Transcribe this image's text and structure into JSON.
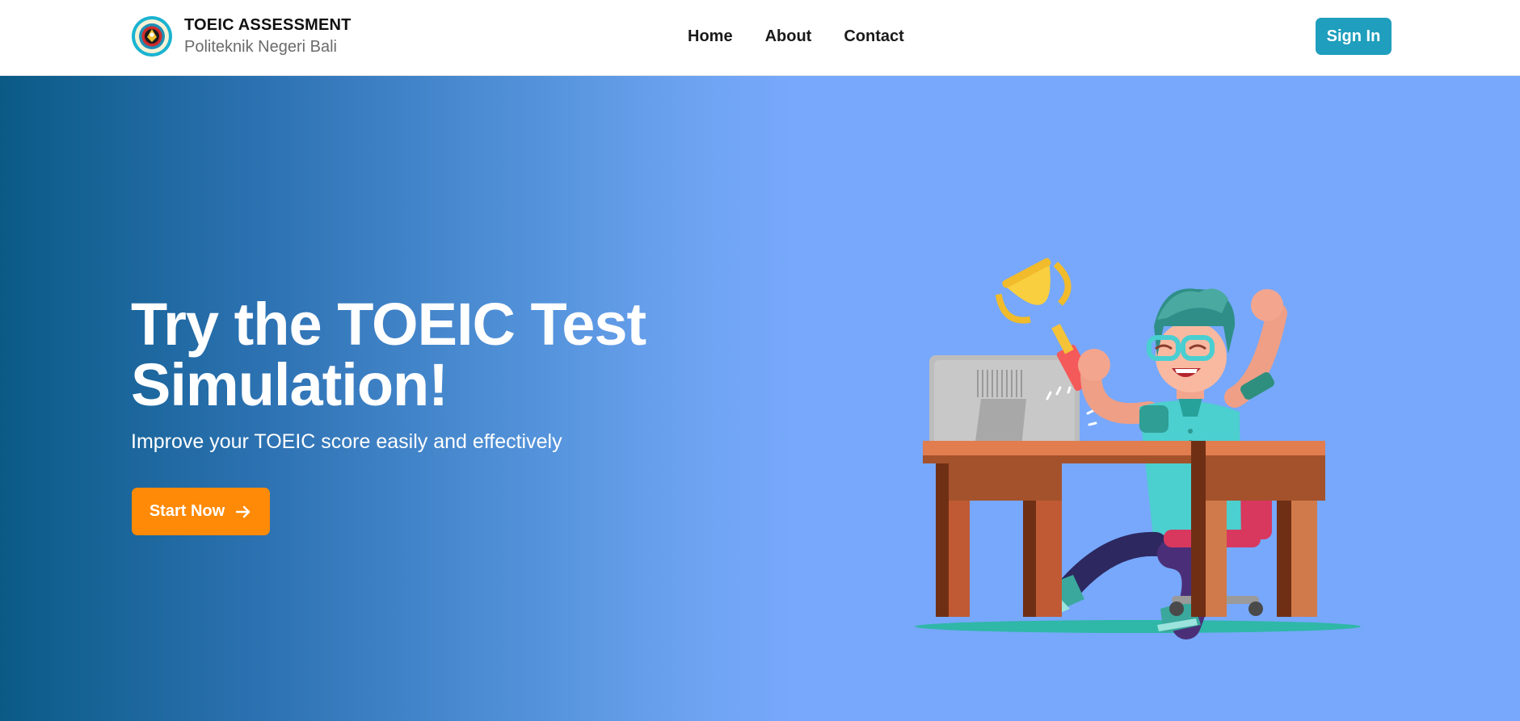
{
  "brand": {
    "title": "TOEIC ASSESSMENT",
    "subtitle": "Politeknik Negeri Bali"
  },
  "nav": {
    "items": [
      {
        "label": "Home"
      },
      {
        "label": "About"
      },
      {
        "label": "Contact"
      }
    ],
    "signin_label": "Sign In"
  },
  "hero": {
    "title_line1": "Try the TOEIC Test",
    "title_line2": "Simulation!",
    "subtitle": "Improve your TOEIC score easily and effectively",
    "cta_label": "Start Now"
  },
  "icons": {
    "logo": "institution-logo",
    "cta": "arrow-right-icon",
    "illustration": "celebrating-student-trophy-illustration"
  },
  "colors": {
    "hero_gradient_start": "#0a5a86",
    "hero_gradient_end": "#77a8fb",
    "signin_bg": "#1f9ebd",
    "cta_bg": "#ff8a07"
  }
}
